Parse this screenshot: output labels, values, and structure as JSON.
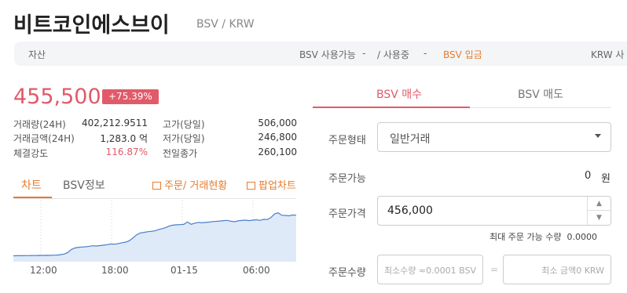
{
  "header": {
    "title": "비트코인에스브이",
    "pair": "BSV / KRW"
  },
  "asset_bar": {
    "label": "자산",
    "available": "BSV 사용가능",
    "available_value": "-",
    "in_use": "/ 사용중",
    "in_use_value": "-",
    "deposit": "BSV 입금",
    "krw": "KRW 사"
  },
  "ticker": {
    "price": "455,500",
    "change": "+75.39%",
    "stats": [
      {
        "label": "거래량(24H)",
        "value": "402,212.9511"
      },
      {
        "label": "거래금액(24H)",
        "value": "1,283.0 억"
      },
      {
        "label": "체결강도",
        "value": "116.87%"
      },
      {
        "label": "고가(당일)",
        "value": "506,000"
      },
      {
        "label": "저가(당일)",
        "value": "246,800"
      },
      {
        "label": "전일종가",
        "value": "260,100"
      }
    ]
  },
  "sub_tabs": {
    "chart": "차트",
    "info": "BSV정보",
    "orders_link": "주문/ 거래현황",
    "popup_chart": "팝업차트"
  },
  "chart_data": {
    "type": "area",
    "x_ticks": [
      "12:00",
      "18:00",
      "01-15",
      "06:00"
    ],
    "colors": {
      "line": "#4a7fc9",
      "fill": "#dfeaf8",
      "grid": "#c8d3e4"
    },
    "values": [
      248000,
      249000,
      248500,
      250000,
      249500,
      250500,
      250000,
      251000,
      250500,
      252000,
      251500,
      253000,
      254000,
      258000,
      262000,
      275000,
      300000,
      312000,
      318000,
      320000,
      322000,
      326000,
      330000,
      328000,
      332000,
      335000,
      340000,
      345000,
      343000,
      348000,
      355000,
      360000,
      372000,
      395000,
      420000,
      435000,
      440000,
      445000,
      448000,
      452000,
      462000,
      470000,
      478000,
      492000,
      499000,
      502000,
      503000,
      505000,
      525000,
      506000,
      515000,
      522000,
      518000,
      521000,
      524000,
      528000,
      530000,
      533000,
      536000,
      538000,
      531000,
      527000,
      534000,
      537000,
      540000,
      536000,
      540000,
      543000,
      538000,
      546000,
      545000,
      560000,
      590000,
      600000,
      580000,
      578000,
      575000,
      582000,
      580000
    ],
    "ylim": [
      200000,
      700000
    ]
  },
  "order": {
    "tabs": [
      "BSV 매수",
      "BSV 매도"
    ],
    "type_label": "주문형태",
    "type_value": "일반거래",
    "available_label": "주문가능",
    "available_value": "0",
    "available_unit": "원",
    "price_label": "주문가격",
    "price_value": "456,000",
    "max_label": "최대 주문 가능 수량",
    "max_value": "0.0000",
    "qty_label": "주문수량",
    "qty_placeholder": "최소수량 ≈0.0001 BSV",
    "eq": "=",
    "amount_placeholder": "최소 금액0 KRW"
  }
}
